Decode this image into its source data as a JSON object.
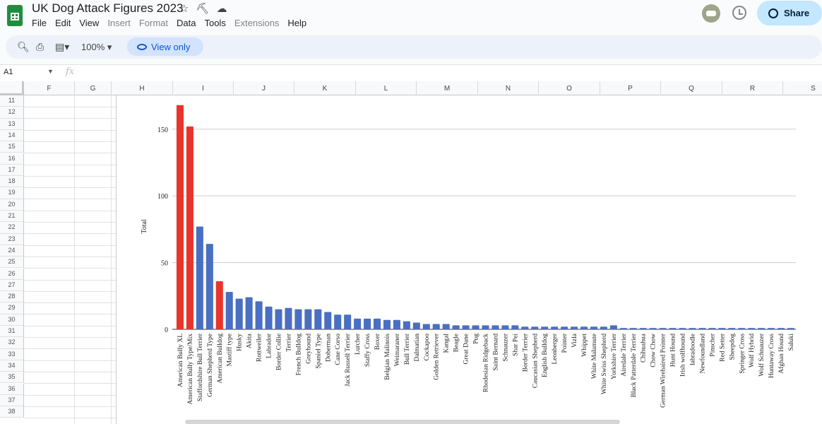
{
  "doc": {
    "title": "UK Dog Attack Figures 2023",
    "menu": [
      {
        "label": "File",
        "enabled": true
      },
      {
        "label": "Edit",
        "enabled": true
      },
      {
        "label": "View",
        "enabled": true
      },
      {
        "label": "Insert",
        "enabled": false
      },
      {
        "label": "Format",
        "enabled": false
      },
      {
        "label": "Data",
        "enabled": true
      },
      {
        "label": "Tools",
        "enabled": true
      },
      {
        "label": "Extensions",
        "enabled": false
      },
      {
        "label": "Help",
        "enabled": true
      }
    ],
    "share_label": "Share",
    "title_icons": [
      "star-icon",
      "move-to-folder-icon",
      "cloud-status-icon"
    ]
  },
  "toolbar": {
    "zoom": "100%",
    "view_only_label": "View only",
    "icons": [
      "search-icon",
      "print-icon",
      "format-icon"
    ]
  },
  "formula_bar": {
    "cell_ref": "A1",
    "fx_label": "fx",
    "value": ""
  },
  "sheet": {
    "columns": [
      "F",
      "G",
      "H",
      "I",
      "J",
      "K",
      "L",
      "M",
      "N",
      "O",
      "P",
      "Q",
      "R",
      "S"
    ],
    "rows": [
      "11",
      "12",
      "13",
      "14",
      "15",
      "16",
      "17",
      "18",
      "19",
      "20",
      "21",
      "22",
      "23",
      "24",
      "25",
      "26",
      "27",
      "28",
      "29",
      "30",
      "31",
      "32",
      "33",
      "34",
      "35",
      "36",
      "37",
      "38"
    ]
  },
  "chart_data": {
    "type": "bar",
    "title": "",
    "xlabel": "",
    "ylabel": "Total",
    "ylim": [
      0,
      170
    ],
    "yticks": [
      0,
      50,
      100,
      150
    ],
    "grid": true,
    "highlight_color": "#e8352b",
    "default_color": "#4a6fc2",
    "categories": [
      "American Bully XL",
      "American Bully Type/Mix",
      "Staffordshire Bull Terrier",
      "German Shepherd Type",
      "American Bulldog",
      "Mastiff type",
      "Husky",
      "Akita",
      "Rottweiler",
      "Labrador",
      "Border Collie",
      "Terrier",
      "French Bulldog",
      "Greyhound",
      "Spaniel Type",
      "Doberman",
      "Cane Corso",
      "Jack Russell Terrier",
      "Lurcher",
      "Staffy Cross",
      "Boxer",
      "Belgian Malinois",
      "Weimaraner",
      "Bull Terrier",
      "Dalmatian",
      "Cockapoo",
      "Golden Retriever",
      "Kangal",
      "Beagle",
      "Great Dane",
      "Pug",
      "Rhodesian Ridgeback",
      "Saint Bernard",
      "Schnauzer",
      "Shar Pei",
      "Border Terrier",
      "Caucasian Shepherd",
      "English Bulldog",
      "Leonberger",
      "Pointer",
      "Vizla",
      "Whippet",
      "White Malamute",
      "White Swiss Shepherd",
      "Yorkshire Terrier",
      "Airedale Terrier",
      "Black Patterdale Terrier",
      "Chihuahua",
      "Chow Chow",
      "German Wirehaired Pointer",
      "Hunt Hound",
      "Irish wolfhound",
      "labradoodle",
      "Newfoundland",
      "Pinscher",
      "Red Setter",
      "Sheepdog",
      "Springer Cross",
      "Wolf Hybrid",
      "Wolf Schnauzer",
      "Huntaway Cross",
      "Afghan Hound",
      "Saluki"
    ],
    "values": [
      168,
      152,
      77,
      64,
      36,
      28,
      23,
      24,
      21,
      17,
      15,
      16,
      15,
      15,
      15,
      13,
      11,
      11,
      8,
      8,
      8,
      7,
      7,
      6,
      5,
      4,
      4,
      4,
      3,
      3,
      3,
      3,
      3,
      3,
      3,
      2,
      2,
      2,
      2,
      2,
      2,
      2,
      2,
      2,
      3,
      1,
      1,
      1,
      1,
      1,
      1,
      1,
      1,
      1,
      1,
      1,
      1,
      1,
      1,
      1,
      1,
      1,
      1
    ],
    "highlighted": [
      "American Bully XL",
      "American Bully Type/Mix",
      "American Bulldog"
    ]
  }
}
